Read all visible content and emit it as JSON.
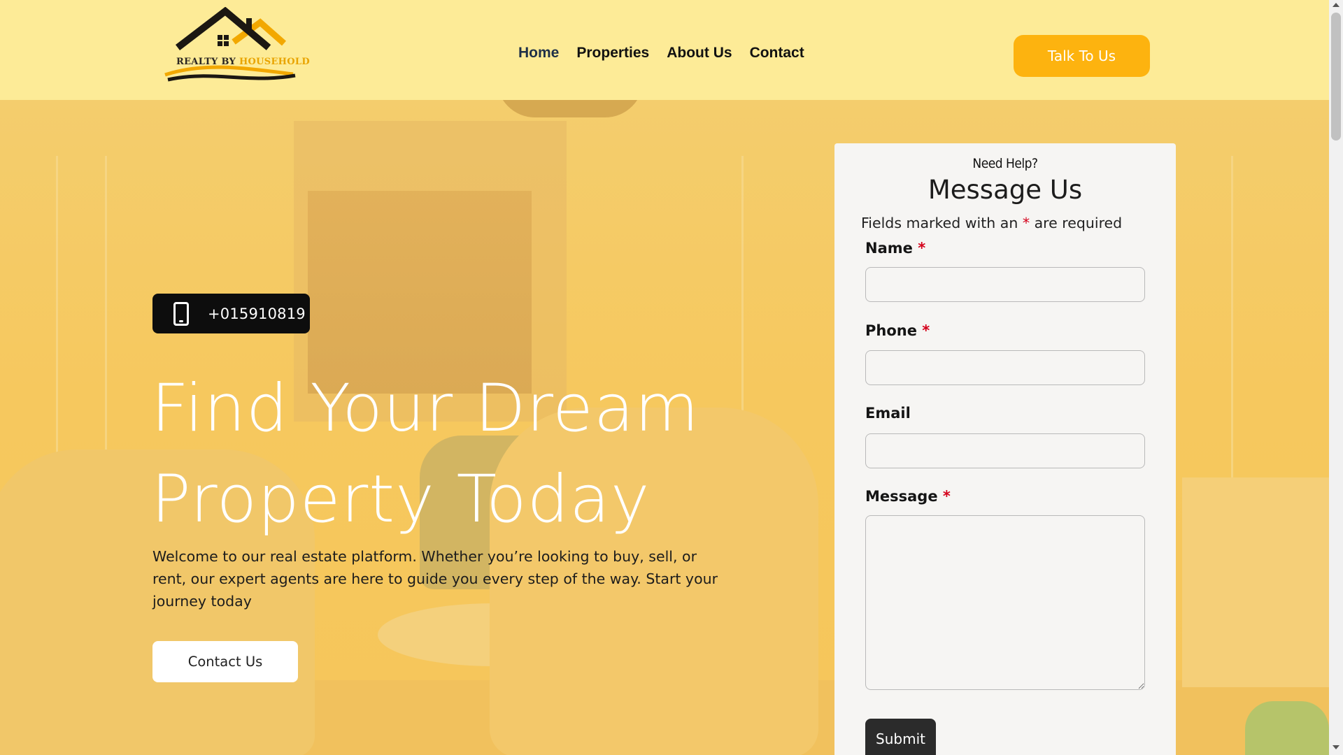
{
  "header": {
    "logo_text_a": "REALTY BY ",
    "logo_text_b": "HOUSEHOLD",
    "nav": [
      "Home",
      "Properties",
      "About Us",
      "Contact"
    ],
    "cta_label": "Talk To Us"
  },
  "hero": {
    "phone": "+015910819",
    "title_line1": "Find Your Dream",
    "title_line2": "Property Today",
    "description": "Welcome to our real estate platform. Whether you’re looking to buy, sell, or rent, our expert agents are here to guide you every step of the way. Start your journey today",
    "contact_button": "Contact Us"
  },
  "form": {
    "eyebrow": "Need Help?",
    "title": "Message Us",
    "required_note_a": "Fields marked with an ",
    "required_star": "*",
    "required_note_b": " are required",
    "name_label": "Name",
    "phone_label": "Phone",
    "email_label": "Email",
    "message_label": "Message",
    "submit_label": "Submit",
    "name_value": "",
    "phone_value": "",
    "email_value": "",
    "message_value": ""
  },
  "colors": {
    "header_bg": "#fdeb97",
    "accent": "#fdb30f",
    "required": "#d4001a",
    "dark": "#0d0d0d"
  },
  "icons": [
    "house-logo-icon",
    "phone-icon",
    "resize-handle-icon"
  ]
}
